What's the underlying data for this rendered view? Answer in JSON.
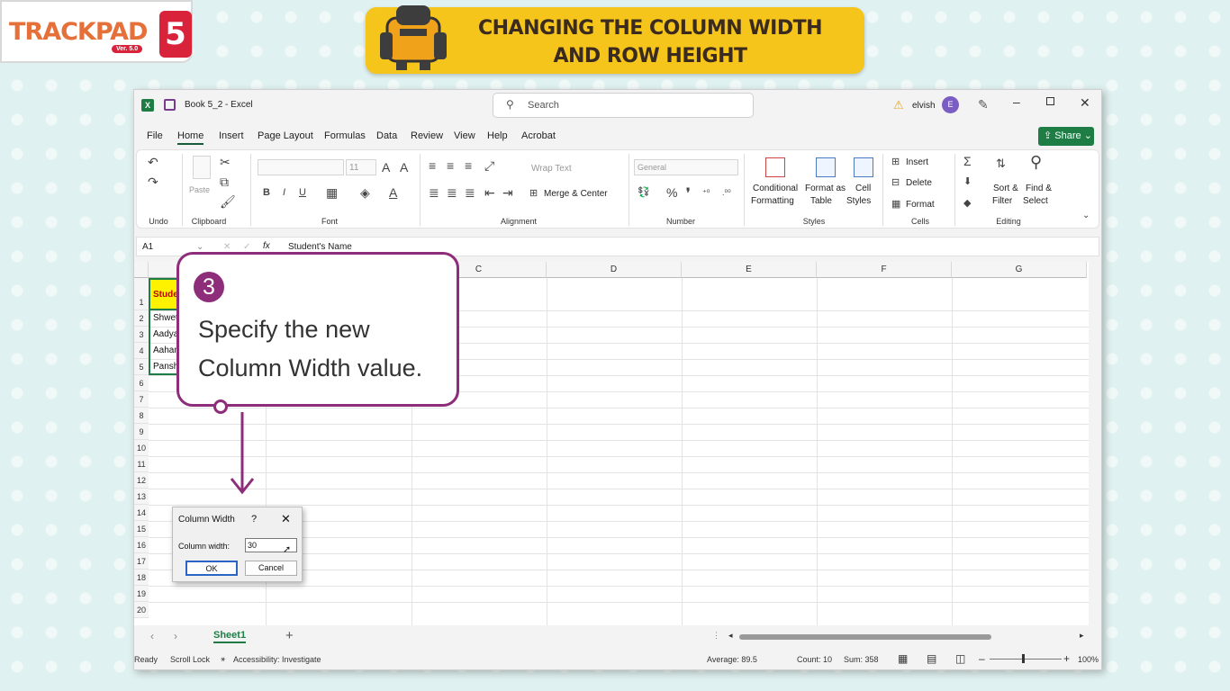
{
  "logo": {
    "text": "TRACKPAD",
    "number": "5",
    "version": "Ver. 5.0"
  },
  "banner": {
    "line1": "CHANGING THE COLUMN WIDTH",
    "line2": "AND ROW HEIGHT"
  },
  "titlebar": {
    "doc_title": "Book 5_2 - Excel",
    "search_placeholder": "Search",
    "user": "elvish",
    "avatar_initial": "E"
  },
  "menu": {
    "items": [
      "File",
      "Home",
      "Insert",
      "Page Layout",
      "Formulas",
      "Data",
      "Review",
      "View",
      "Help",
      "Acrobat"
    ],
    "share": "Share"
  },
  "ribbon": {
    "groups": {
      "undo": "Undo",
      "clipboard": "Clipboard",
      "font": "Font",
      "alignment": "Alignment",
      "number": "Number",
      "styles": "Styles",
      "cells": "Cells",
      "editing": "Editing"
    },
    "paste": "Paste",
    "font_size": "11",
    "wrap_text": "Wrap Text",
    "merge_center": "Merge & Center",
    "number_format": "General",
    "conditional_1": "Conditional",
    "conditional_2": "Formatting",
    "format_table_1": "Format as",
    "format_table_2": "Table",
    "cell_styles_1": "Cell",
    "cell_styles_2": "Styles",
    "insert": "Insert",
    "delete": "Delete",
    "format": "Format",
    "sort_1": "Sort &",
    "sort_2": "Filter",
    "find_1": "Find &",
    "find_2": "Select"
  },
  "formula_bar": {
    "name_box": "A1",
    "fx": "fx",
    "content": "Student's Name"
  },
  "columns": [
    "C",
    "D",
    "E",
    "F",
    "G"
  ],
  "rows": [
    "1",
    "2",
    "3",
    "4",
    "5",
    "6",
    "7",
    "8",
    "9",
    "10",
    "11",
    "12",
    "13",
    "14",
    "15",
    "16",
    "17",
    "18",
    "19",
    "20"
  ],
  "cells": {
    "a1": "Student",
    "a2": "Shwet",
    "a3": "Aadya",
    "a4": "Aahan",
    "a5": "Pansh"
  },
  "sheet_tab": "Sheet1",
  "status": {
    "ready": "Ready",
    "scroll_lock": "Scroll Lock",
    "accessibility": "Accessibility: Investigate",
    "average": "Average: 89.5",
    "count": "Count: 10",
    "sum": "Sum: 358",
    "zoom": "100%"
  },
  "callout": {
    "step": "3",
    "line1": "Specify the new",
    "line2": "Column Width value."
  },
  "dialog": {
    "title": "Column Width",
    "help": "?",
    "field_label": "Column width:",
    "field_value": "30",
    "ok": "OK",
    "cancel": "Cancel"
  },
  "colors": {
    "accent_green": "#1e7d45",
    "callout_purple": "#8e2d7a",
    "banner_yellow": "#f5c51b",
    "cell_highlight": "#fff200"
  }
}
